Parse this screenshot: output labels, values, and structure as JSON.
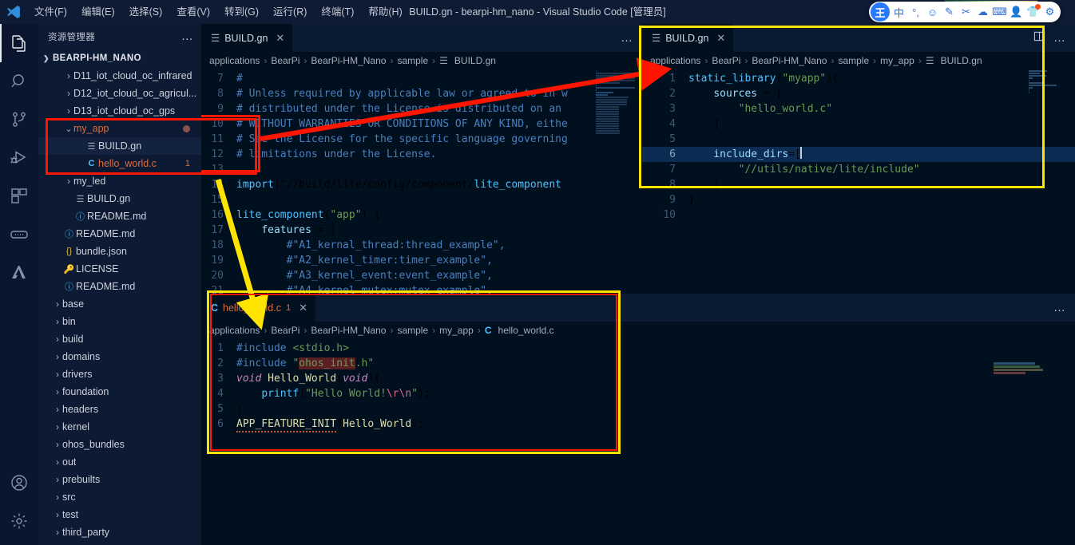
{
  "titlebar": {
    "window_title": "BUILD.gn - bearpi-hm_nano - Visual Studio Code [管理员]",
    "menus": [
      "文件(F)",
      "编辑(E)",
      "选择(S)",
      "查看(V)",
      "转到(G)",
      "运行(R)",
      "终端(T)",
      "帮助(H)"
    ],
    "ime": {
      "logo": "王",
      "icons": [
        "中",
        "°,",
        "☺",
        "✎",
        "✂",
        "☁",
        "⌨",
        "👤",
        "👕",
        "⚙"
      ]
    }
  },
  "activitybar": {
    "items": [
      {
        "name": "explorer",
        "glyph": "files-icon"
      },
      {
        "name": "search",
        "glyph": "search-icon"
      },
      {
        "name": "source-control",
        "glyph": "source-control-icon"
      },
      {
        "name": "run-debug",
        "glyph": "debug-icon"
      },
      {
        "name": "extensions",
        "glyph": "extensions-icon"
      },
      {
        "name": "remote",
        "glyph": "remote-icon"
      },
      {
        "name": "deveco",
        "glyph": "deveco-icon"
      }
    ],
    "bottom": [
      {
        "name": "accounts",
        "glyph": "account-icon"
      },
      {
        "name": "settings",
        "glyph": "gear-icon"
      }
    ]
  },
  "sidebar": {
    "title": "资源管理器",
    "more_label": "…",
    "root": "BEARPI-HM_NANO",
    "tree": [
      {
        "label": "D11_iot_cloud_oc_infrared",
        "indent": 2,
        "kind": "folder",
        "expanded": false
      },
      {
        "label": "D12_iot_cloud_oc_agricul...",
        "indent": 2,
        "kind": "folder",
        "expanded": false
      },
      {
        "label": "D13_iot_cloud_oc_gps",
        "indent": 2,
        "kind": "folder",
        "expanded": false
      },
      {
        "label": "my_app",
        "indent": 2,
        "kind": "folder",
        "expanded": true,
        "color": "orange",
        "modified": true
      },
      {
        "label": "BUILD.gn",
        "indent": 3,
        "kind": "gn",
        "selected": true
      },
      {
        "label": "hello_world.c",
        "indent": 3,
        "kind": "c",
        "color": "orange",
        "badge": "1"
      },
      {
        "label": "my_led",
        "indent": 2,
        "kind": "folder",
        "expanded": false
      },
      {
        "label": "BUILD.gn",
        "indent": 2,
        "kind": "gn"
      },
      {
        "label": "README.md",
        "indent": 2,
        "kind": "md"
      },
      {
        "label": "README.md",
        "indent": 1,
        "kind": "md"
      },
      {
        "label": "bundle.json",
        "indent": 1,
        "kind": "json"
      },
      {
        "label": "LICENSE",
        "indent": 1,
        "kind": "license"
      },
      {
        "label": "README.md",
        "indent": 1,
        "kind": "md"
      },
      {
        "label": "base",
        "indent": 1,
        "kind": "folder",
        "expanded": false
      },
      {
        "label": "bin",
        "indent": 1,
        "kind": "folder",
        "expanded": false
      },
      {
        "label": "build",
        "indent": 1,
        "kind": "folder",
        "expanded": false
      },
      {
        "label": "domains",
        "indent": 1,
        "kind": "folder",
        "expanded": false
      },
      {
        "label": "drivers",
        "indent": 1,
        "kind": "folder",
        "expanded": false
      },
      {
        "label": "foundation",
        "indent": 1,
        "kind": "folder",
        "expanded": false
      },
      {
        "label": "headers",
        "indent": 1,
        "kind": "folder",
        "expanded": false
      },
      {
        "label": "kernel",
        "indent": 1,
        "kind": "folder",
        "expanded": false
      },
      {
        "label": "ohos_bundles",
        "indent": 1,
        "kind": "folder",
        "expanded": false
      },
      {
        "label": "out",
        "indent": 1,
        "kind": "folder",
        "expanded": false
      },
      {
        "label": "prebuilts",
        "indent": 1,
        "kind": "folder",
        "expanded": false
      },
      {
        "label": "src",
        "indent": 1,
        "kind": "folder",
        "expanded": false
      },
      {
        "label": "test",
        "indent": 1,
        "kind": "folder",
        "expanded": false
      },
      {
        "label": "third_party",
        "indent": 1,
        "kind": "folder",
        "expanded": false
      }
    ]
  },
  "editor_main": {
    "tab": {
      "label": "BUILD.gn",
      "icon": "gn-file-icon",
      "close": "✕"
    },
    "more": "…",
    "breadcrumb": [
      "applications",
      "BearPi",
      "BearPi-HM_Nano",
      "sample",
      "BUILD.gn"
    ],
    "lines": [
      {
        "n": "7",
        "text": "#"
      },
      {
        "n": "8",
        "text": "# Unless required by applicable law or agreed to in w"
      },
      {
        "n": "9",
        "text": "# distributed under the License is distributed on an"
      },
      {
        "n": "10",
        "text": "# WITHOUT WARRANTIES OR CONDITIONS OF ANY KIND, eithe"
      },
      {
        "n": "11",
        "text": "# See the License for the specific language governing"
      },
      {
        "n": "12",
        "text": "# limitations under the License."
      },
      {
        "n": "13",
        "text": ""
      },
      {
        "n": "14",
        "text": "import(\"//build/lite/config/component/lite_component."
      },
      {
        "n": "15",
        "text": ""
      },
      {
        "n": "16",
        "text": "lite_component(\"app\") {"
      },
      {
        "n": "17",
        "text": "    features = ["
      },
      {
        "n": "18",
        "text": "        #\"A1_kernal_thread:thread_example\","
      },
      {
        "n": "19",
        "text": "        #\"A2_kernel_timer:timer_example\","
      },
      {
        "n": "20",
        "text": "        #\"A3_kernel_event:event_example\","
      },
      {
        "n": "21",
        "text": "        #\"A4_kernel_mutex:mutex_example\","
      }
    ]
  },
  "editor_topright": {
    "tab": {
      "label": "BUILD.gn",
      "icon": "gn-file-icon",
      "close": "✕"
    },
    "split_icon": "split-editor-icon",
    "more": "…",
    "breadcrumb": [
      "applications",
      "BearPi",
      "BearPi-HM_Nano",
      "sample",
      "my_app",
      "BUILD.gn"
    ],
    "lines": [
      {
        "n": "1",
        "text": "static_library(\"myapp\"){"
      },
      {
        "n": "2",
        "text": "    sources = ["
      },
      {
        "n": "3",
        "text": "        \"hello_world.c\""
      },
      {
        "n": "4",
        "text": "    ]"
      },
      {
        "n": "5",
        "text": ""
      },
      {
        "n": "6",
        "text": "    include_dirs=[",
        "current": true
      },
      {
        "n": "7",
        "text": "        \"//utils/native/lite/include\""
      },
      {
        "n": "8",
        "text": "    ]"
      },
      {
        "n": "9",
        "text": "}"
      },
      {
        "n": "10",
        "text": ""
      }
    ]
  },
  "editor_bottom": {
    "tab": {
      "label": "hello_world.c",
      "icon": "c-file-icon",
      "badge": "1",
      "close": "✕"
    },
    "breadcrumb": [
      "applications",
      "BearPi",
      "BearPi-HM_Nano",
      "sample",
      "my_app",
      "hello_world.c"
    ],
    "lines": [
      {
        "n": "1",
        "text": "#include <stdio.h>"
      },
      {
        "n": "2",
        "text": "#include \"ohos_init.h\""
      },
      {
        "n": "3",
        "text": "void Hello_World(void){"
      },
      {
        "n": "4",
        "text": "    printf(\"Hello World!\\r\\n\");"
      },
      {
        "n": "5",
        "text": "}"
      },
      {
        "n": "6",
        "text": "APP_FEATURE_INIT(Hello_World);"
      }
    ]
  },
  "editor_bottomright": {
    "more": "…"
  },
  "annotations": {
    "red_box_sidebar": "highlights my_app folder with BUILD.gn and hello_world.c",
    "red_arrow": "points from main BUILD.gn to top-right my_app BUILD.gn",
    "yellow_arrow": "points from main editor down to hello_world.c panel",
    "yellow_box_topright": "highlights my_app BUILD.gn editor",
    "yellow_box_bottom": "highlights hello_world.c editor",
    "colors": {
      "red": "#ff1500",
      "yellow": "#ffe400"
    }
  }
}
